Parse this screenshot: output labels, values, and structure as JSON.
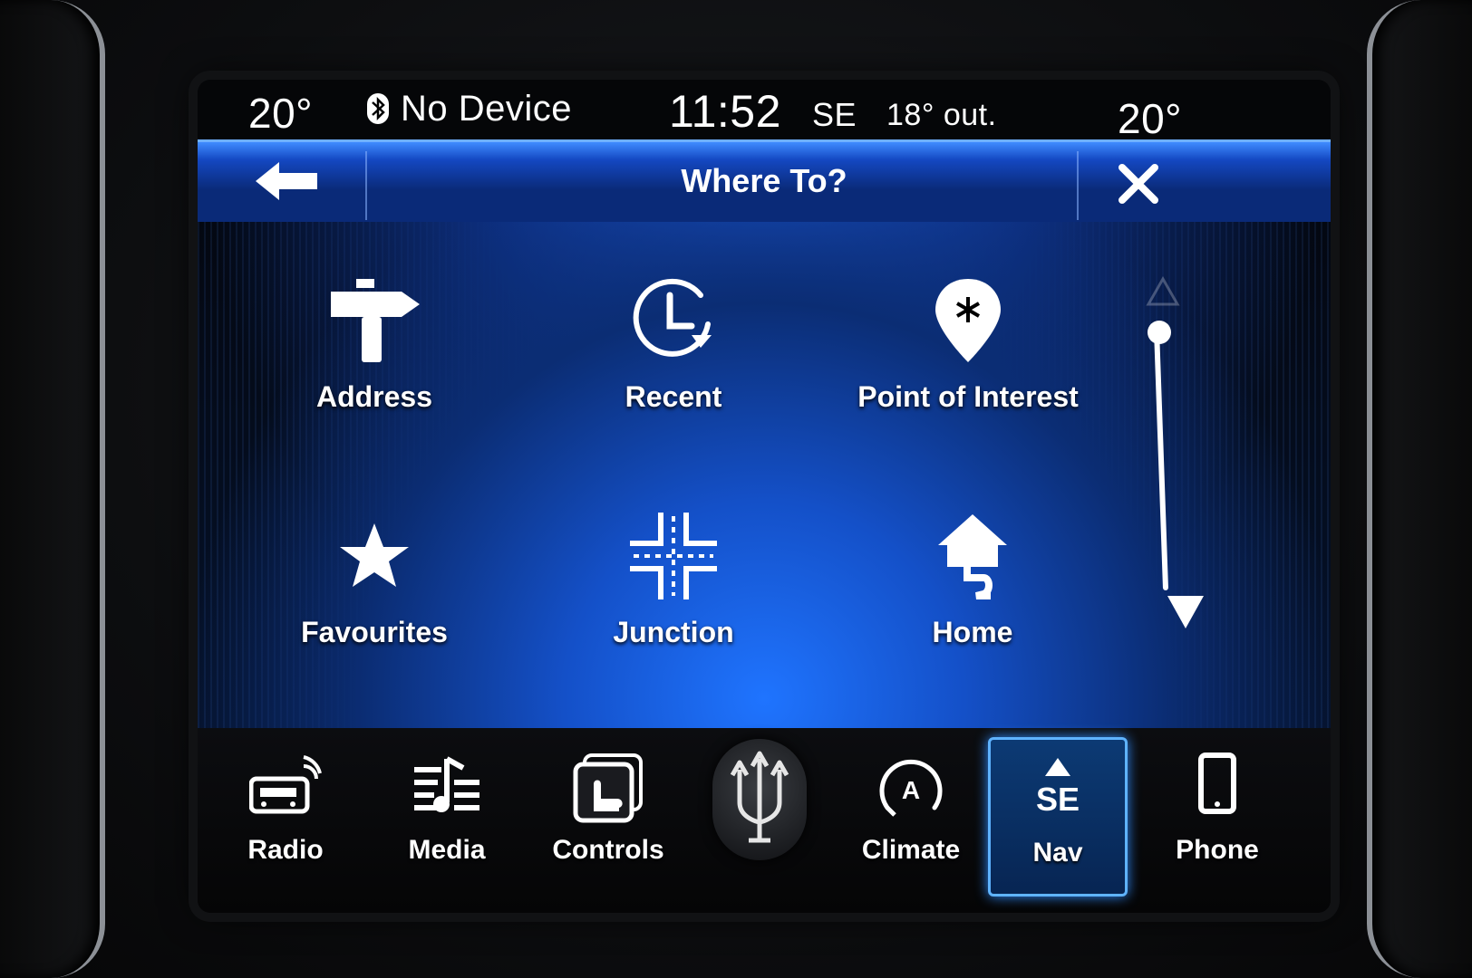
{
  "status": {
    "temp_left": "20°",
    "device": "No Device",
    "time": "11:52",
    "heading": "SE",
    "outside": "18° out.",
    "temp_right": "20°"
  },
  "header": {
    "title": "Where To?"
  },
  "tiles": [
    {
      "label": "Address",
      "icon": "signpost-icon"
    },
    {
      "label": "Recent",
      "icon": "clock-icon"
    },
    {
      "label": "Point of Interest",
      "icon": "poi-pin-icon"
    },
    {
      "label": "Favourites",
      "icon": "star-icon"
    },
    {
      "label": "Junction",
      "icon": "junction-icon"
    },
    {
      "label": "Home",
      "icon": "home-icon"
    }
  ],
  "nav": [
    {
      "label": "Radio",
      "icon": "radio-icon"
    },
    {
      "label": "Media",
      "icon": "media-icon"
    },
    {
      "label": "Controls",
      "icon": "controls-icon"
    },
    {
      "label": "Climate",
      "icon": "climate-icon"
    },
    {
      "label": "Nav",
      "icon": "nav-compass-icon",
      "heading": "SE",
      "active": true
    },
    {
      "label": "Phone",
      "icon": "phone-icon"
    }
  ],
  "colors": {
    "accent": "#2f8cff",
    "title_bar": "#0a2a78"
  }
}
